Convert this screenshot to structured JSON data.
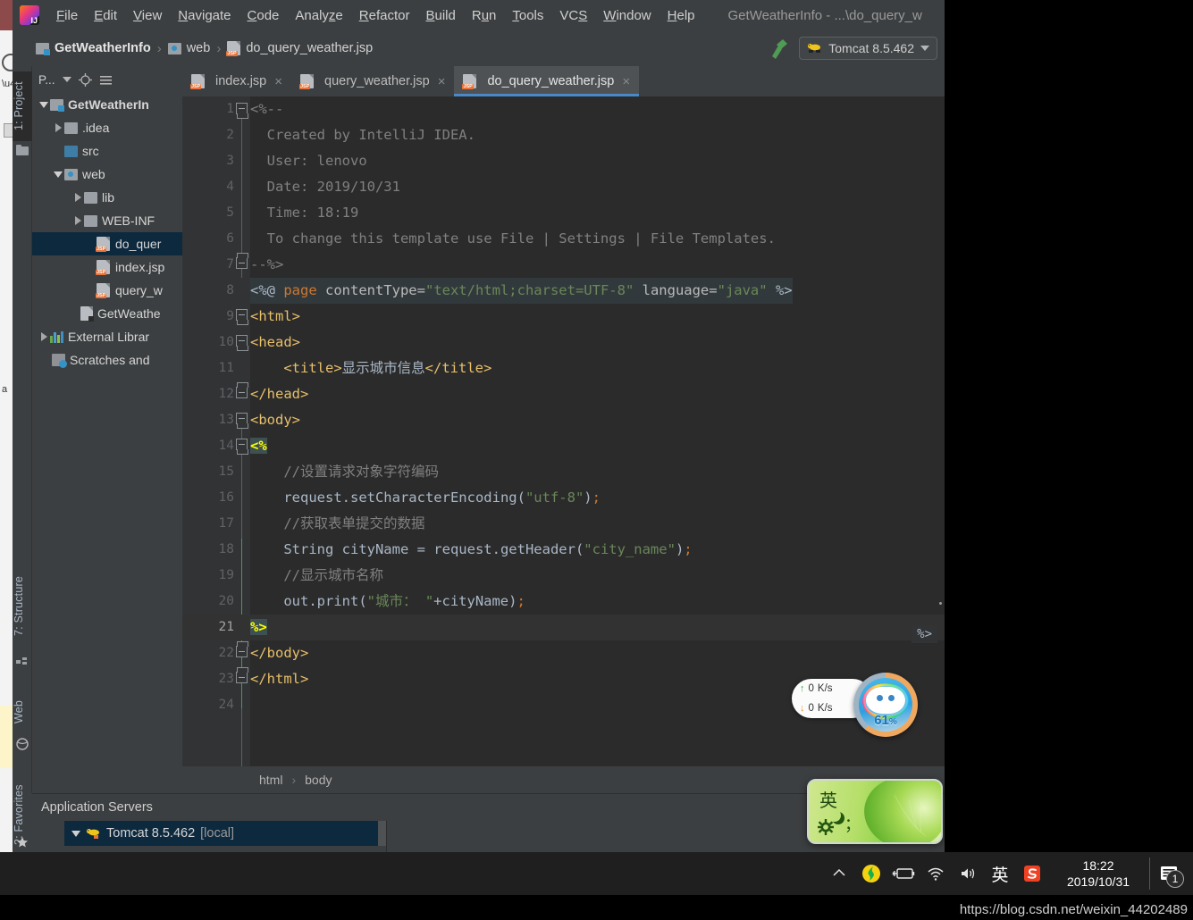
{
  "window": {
    "title": "GetWeatherInfo - ...\\do_query_w",
    "logo_icon": "intellij-idea-logo"
  },
  "menubar": {
    "items": [
      {
        "label": "File",
        "mnemonic": "F"
      },
      {
        "label": "Edit",
        "mnemonic": "E"
      },
      {
        "label": "View",
        "mnemonic": "V"
      },
      {
        "label": "Navigate",
        "mnemonic": "N"
      },
      {
        "label": "Code",
        "mnemonic": "C"
      },
      {
        "label": "Analyze",
        "mnemonic": "z"
      },
      {
        "label": "Refactor",
        "mnemonic": "R"
      },
      {
        "label": "Build",
        "mnemonic": "B"
      },
      {
        "label": "Run",
        "mnemonic": "u"
      },
      {
        "label": "Tools",
        "mnemonic": "T"
      },
      {
        "label": "VCS",
        "mnemonic": "S"
      },
      {
        "label": "Window",
        "mnemonic": "W"
      },
      {
        "label": "Help",
        "mnemonic": "H"
      }
    ]
  },
  "navbar": {
    "crumbs": [
      {
        "label": "GetWeatherInfo",
        "icon": "module-icon"
      },
      {
        "label": "web",
        "icon": "web-folder-icon"
      },
      {
        "label": "do_query_weather.jsp",
        "icon": "jsp-file-icon"
      }
    ],
    "separator": "›",
    "build_icon": "hammer-icon",
    "run_config": {
      "label": "Tomcat 8.5.462",
      "icon": "tomcat-icon",
      "dropdown_icon": "chevron-down-icon"
    }
  },
  "left_toolbar": {
    "top_tabs": [
      {
        "label": "1: Project",
        "icon": "folder-icon",
        "active": true
      }
    ],
    "bottom_tabs": [
      {
        "label": "7: Structure",
        "icon": "structure-icon"
      },
      {
        "label": "Web",
        "icon": "globe-icon"
      },
      {
        "label": "2: Favorites",
        "icon": "star-icon"
      }
    ]
  },
  "project_panel": {
    "title": "P...",
    "icons": [
      "settings-gear-icon",
      "locate-target-icon",
      "collapse-all-icon"
    ],
    "tree": [
      {
        "label": "GetWeatherIn",
        "depth": 0,
        "twisty": "down",
        "icon": "module-icon",
        "bold": true
      },
      {
        "label": ".idea",
        "depth": 1,
        "twisty": "right",
        "icon": "folder-icon"
      },
      {
        "label": "src",
        "depth": 1,
        "twisty": "none",
        "icon": "source-folder-icon"
      },
      {
        "label": "web",
        "depth": 1,
        "twisty": "down",
        "icon": "web-folder-icon"
      },
      {
        "label": "lib",
        "depth": 2,
        "twisty": "right",
        "icon": "folder-icon"
      },
      {
        "label": "WEB-INF",
        "depth": 2,
        "twisty": "right",
        "icon": "folder-icon"
      },
      {
        "label": "do_quer",
        "depth": 3,
        "twisty": "none",
        "icon": "jsp-file-icon",
        "selected": true
      },
      {
        "label": "index.jsp",
        "depth": 3,
        "twisty": "none",
        "icon": "jsp-file-icon"
      },
      {
        "label": "query_w",
        "depth": 3,
        "twisty": "none",
        "icon": "jsp-file-icon"
      },
      {
        "label": "GetWeathe",
        "depth": 2,
        "twisty": "none",
        "icon": "iml-file-icon"
      },
      {
        "label": "External Librar",
        "depth": 0,
        "twisty": "right",
        "icon": "libraries-icon"
      },
      {
        "label": "Scratches and",
        "depth": 0,
        "twisty": "none",
        "icon": "scratches-icon"
      }
    ]
  },
  "editor": {
    "tabs": [
      {
        "label": "index.jsp",
        "icon": "jsp-file-icon",
        "active": false
      },
      {
        "label": "query_weather.jsp",
        "icon": "jsp-file-icon",
        "active": false
      },
      {
        "label": "do_query_weather.jsp",
        "icon": "jsp-file-icon",
        "active": true
      }
    ],
    "close_icon": "×",
    "current_line": 21,
    "lines": [
      {
        "n": 1,
        "fold": "open",
        "segs": [
          {
            "t": "<%--",
            "c": "c-cmt"
          }
        ]
      },
      {
        "n": 2,
        "segs": [
          {
            "t": "  Created by IntelliJ IDEA.",
            "c": "c-cmt"
          }
        ]
      },
      {
        "n": 3,
        "segs": [
          {
            "t": "  User: lenovo",
            "c": "c-cmt"
          }
        ]
      },
      {
        "n": 4,
        "segs": [
          {
            "t": "  Date: 2019/10/31",
            "c": "c-cmt"
          }
        ]
      },
      {
        "n": 5,
        "segs": [
          {
            "t": "  Time: 18:19",
            "c": "c-cmt"
          }
        ]
      },
      {
        "n": 6,
        "segs": [
          {
            "t": "  To change this template use File | Settings | File Templates.",
            "c": "c-cmt"
          }
        ]
      },
      {
        "n": 7,
        "fold": "close",
        "segs": [
          {
            "t": "--%>",
            "c": "c-cmt"
          }
        ]
      },
      {
        "n": 8,
        "hl": "directive",
        "segs": [
          {
            "t": "<%@ ",
            "c": "c-txt"
          },
          {
            "t": "page",
            "c": "c-kw"
          },
          {
            "t": " contentType=",
            "c": "c-attr"
          },
          {
            "t": "\"text/html;charset=UTF-8\"",
            "c": "c-str"
          },
          {
            "t": " language=",
            "c": "c-attr"
          },
          {
            "t": "\"java\"",
            "c": "c-str"
          },
          {
            "t": " %>",
            "c": "c-txt"
          }
        ]
      },
      {
        "n": 9,
        "fold": "open",
        "segs": [
          {
            "t": "<html>",
            "c": "c-tag"
          }
        ]
      },
      {
        "n": 10,
        "fold": "open",
        "segs": [
          {
            "t": "<head>",
            "c": "c-tag"
          }
        ]
      },
      {
        "n": 11,
        "segs": [
          {
            "t": "    <title>",
            "c": "c-tag"
          },
          {
            "t": "显示城市信息",
            "c": "c-txt"
          },
          {
            "t": "</title>",
            "c": "c-tag"
          }
        ]
      },
      {
        "n": 12,
        "fold": "close",
        "segs": [
          {
            "t": "</head>",
            "c": "c-tag"
          }
        ]
      },
      {
        "n": 13,
        "fold": "open",
        "segs": [
          {
            "t": "<body>",
            "c": "c-tag"
          }
        ]
      },
      {
        "n": 14,
        "fold": "open",
        "segs": [
          {
            "t": "<%",
            "c": "hl-scriptlet"
          }
        ]
      },
      {
        "n": 15,
        "segs": [
          {
            "t": "    //设置请求对象字符编码",
            "c": "c-cmt"
          }
        ]
      },
      {
        "n": 16,
        "segs": [
          {
            "t": "    request.setCharacterEncoding(",
            "c": "c-txt"
          },
          {
            "t": "\"utf-8\"",
            "c": "c-str"
          },
          {
            "t": ")",
            "c": "c-txt"
          },
          {
            "t": ";",
            "c": "c-punc"
          }
        ]
      },
      {
        "n": 17,
        "segs": [
          {
            "t": "    //获取表单提交的数据",
            "c": "c-cmt"
          }
        ]
      },
      {
        "n": 18,
        "segs": [
          {
            "t": "    String cityName = request.getHeader(",
            "c": "c-txt"
          },
          {
            "t": "\"city_name\"",
            "c": "c-str"
          },
          {
            "t": ")",
            "c": "c-txt"
          },
          {
            "t": ";",
            "c": "c-punc"
          }
        ]
      },
      {
        "n": 19,
        "segs": [
          {
            "t": "    //显示城市名称",
            "c": "c-cmt"
          }
        ]
      },
      {
        "n": 20,
        "segs": [
          {
            "t": "    out.print(",
            "c": "c-txt"
          },
          {
            "t": "\"城市： \"",
            "c": "c-str"
          },
          {
            "t": "+cityName)",
            "c": "c-txt"
          },
          {
            "t": ";",
            "c": "c-punc"
          }
        ]
      },
      {
        "n": 21,
        "fold": "close",
        "current": true,
        "segs": [
          {
            "t": "%>",
            "c": "hl-scriptlet"
          }
        ]
      },
      {
        "n": 22,
        "fold": "close",
        "segs": [
          {
            "t": "</body>",
            "c": "c-tag"
          }
        ]
      },
      {
        "n": 23,
        "fold": "close",
        "segs": [
          {
            "t": "</html>",
            "c": "c-tag"
          }
        ]
      },
      {
        "n": 24,
        "segs": [
          {
            "t": "",
            "c": "c-txt"
          }
        ]
      }
    ],
    "minimap_fragment": "%>",
    "breadcrumb": {
      "items": [
        "html",
        "body"
      ],
      "separator": "›"
    }
  },
  "bottom_panel": {
    "title": "Application Servers",
    "server": {
      "label": "Tomcat 8.5.462",
      "suffix": "[local]",
      "icon": "tomcat-icon",
      "twisty": "down"
    }
  },
  "net_widget": {
    "upload": {
      "arrow": "↑",
      "value": "0",
      "unit": "K/s"
    },
    "download": {
      "arrow": "↓",
      "value": "0",
      "unit": "K/s"
    },
    "percent": "61",
    "percent_unit": "%"
  },
  "ime_bar": {
    "mode": "英",
    "moon_icon": "moon-icon",
    "gear_icon": "gear-icon",
    "punctuation": "；"
  },
  "taskbar": {
    "tray": [
      {
        "icon": "chevron-up-icon",
        "glyph": "⌃"
      },
      {
        "icon": "360-safe-icon",
        "glyph": ""
      },
      {
        "icon": "battery-icon",
        "glyph": ""
      },
      {
        "icon": "wifi-icon",
        "glyph": ""
      },
      {
        "icon": "volume-icon",
        "glyph": ""
      },
      {
        "icon": "ime-indicator-icon",
        "glyph": "英"
      },
      {
        "icon": "sogou-icon",
        "glyph": "S"
      }
    ],
    "clock": {
      "time": "18:22",
      "date": "2019/10/31"
    },
    "action_center": {
      "icon": "notification-icon",
      "badge": "1"
    }
  },
  "watermark": "https://blog.csdn.net/weixin_44202489",
  "colors": {
    "ide_chrome": "#3c3f41",
    "editor_bg": "#2b2b2b",
    "gutter_bg": "#313335",
    "selection_blue": "#0d293e",
    "tab_accent": "#4a88c7",
    "comment_gray": "#808080",
    "string_green": "#6a8759",
    "keyword_orange": "#cc7832",
    "tag_yellow": "#e8bf6a"
  }
}
